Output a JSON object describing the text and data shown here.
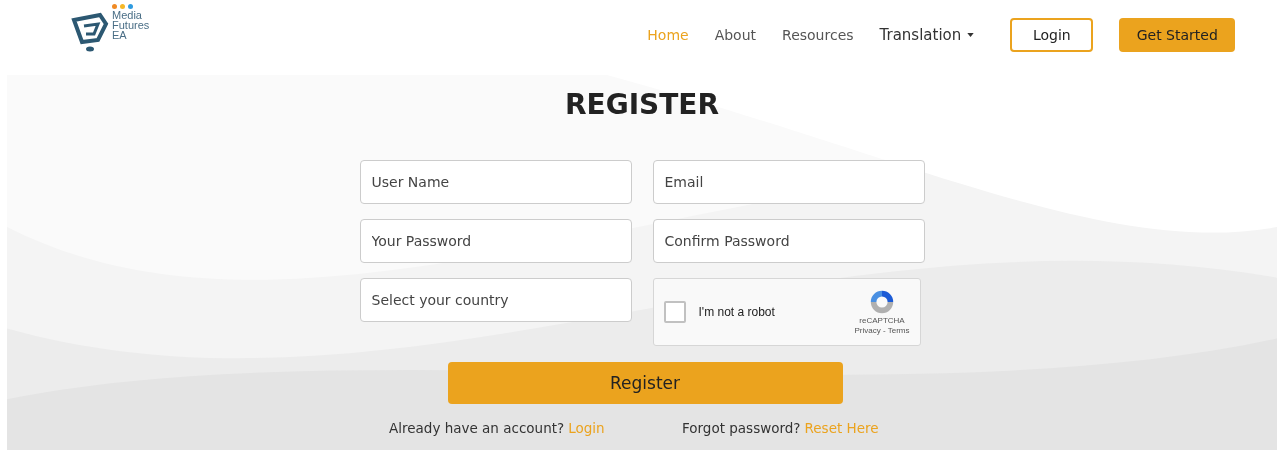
{
  "logo": {
    "lines": [
      "Media",
      "Futures",
      "EA"
    ],
    "dots": [
      {
        "color": "#f08a24"
      },
      {
        "color": "#f5b828"
      },
      {
        "color": "#2f9be0"
      }
    ]
  },
  "nav": [
    {
      "label": "Home",
      "selected": true,
      "kind": "link"
    },
    {
      "label": "About",
      "selected": false,
      "kind": "link"
    },
    {
      "label": "Resources",
      "selected": false,
      "kind": "link"
    },
    {
      "label": "Translation",
      "selected": false,
      "kind": "dropdown"
    }
  ],
  "header_buttons": [
    {
      "label": "Login",
      "kind": "outline"
    },
    {
      "label": "Get Started",
      "kind": "filled"
    }
  ],
  "title": "REGISTER",
  "fields": [
    {
      "placeholder": "User Name"
    },
    {
      "placeholder": "Email"
    },
    {
      "placeholder": "Your Password"
    },
    {
      "placeholder": "Confirm Password"
    },
    {
      "placeholder": "Select your country"
    }
  ],
  "captcha": {
    "label": "I'm not a robot",
    "checked": false,
    "brand": "reCAPTCHA",
    "links": "Privacy - Terms"
  },
  "submit": "Register",
  "footer": [
    {
      "text": "Already have an account?",
      "link": "Login"
    },
    {
      "text": "Forgot password?",
      "link": "Reset Here"
    }
  ]
}
